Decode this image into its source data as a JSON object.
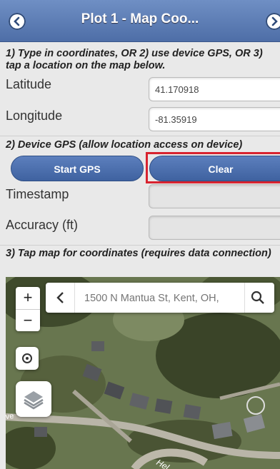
{
  "header": {
    "title": "Plot 1 - Map Coo..."
  },
  "instructions": "1) Type in coordinates, OR 2) use device GPS, OR 3) tap a location on the map below.",
  "coordinates": {
    "latitude_label": "Latitude",
    "latitude_value": "41.170918",
    "longitude_label": "Longitude",
    "longitude_value": "-81.35919"
  },
  "gps": {
    "heading": "2) Device GPS (allow location access on device)",
    "start_label": "Start GPS",
    "clear_label": "Clear",
    "timestamp_label": "Timestamp",
    "accuracy_label": "Accuracy (ft)"
  },
  "map_section": {
    "heading": "3) Tap map for coordinates (requires data connection)",
    "zoom_in": "+",
    "zoom_out": "−",
    "search_placeholder": "1500 N Mantua St, Kent, OH,",
    "street_labels": [
      "ve",
      "Hel"
    ]
  },
  "colors": {
    "header": "#5a7ab5",
    "button": "#4a6dab",
    "highlight": "#d8232f"
  }
}
